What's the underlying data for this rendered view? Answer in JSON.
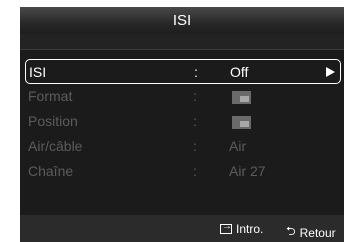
{
  "title": "ISI",
  "menu": [
    {
      "label": "ISI",
      "colon": ":",
      "value": "Off",
      "has_arrow": true,
      "selected": true
    },
    {
      "label": "Format",
      "colon": ":",
      "value": "",
      "icon": "format-thumbnail-icon"
    },
    {
      "label": "Position",
      "colon": ":",
      "value": "",
      "icon": "position-thumbnail-icon"
    },
    {
      "label": "Air/câble",
      "colon": ":",
      "value": "Air"
    },
    {
      "label": "Chaîne",
      "colon": ":",
      "value": "Air 27"
    }
  ],
  "footer": {
    "enter_icon": "enter-icon",
    "enter_label": "Intro.",
    "return_icon": "return-icon",
    "return_glyph": "⮌",
    "return_label": "Retour"
  },
  "colors": {
    "panel": "#1b1b1b",
    "selected_text": "#ffffff",
    "disabled_text": "#5c5c5c"
  }
}
